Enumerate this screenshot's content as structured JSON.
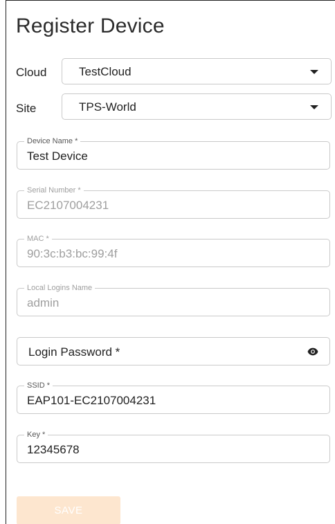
{
  "page": {
    "title": "Register Device"
  },
  "cloud": {
    "label": "Cloud",
    "value": "TestCloud"
  },
  "site": {
    "label": "Site",
    "value": "TPS-World"
  },
  "fields": {
    "device_name": {
      "label": "Device Name *",
      "value": "Test Device"
    },
    "serial_number": {
      "label": "Serial Number *",
      "value": "EC2107004231"
    },
    "mac": {
      "label": "MAC *",
      "value": "90:3c:b3:bc:99:4f"
    },
    "local_logins_name": {
      "label": "Local Logins Name",
      "value": "admin"
    },
    "login_password": {
      "label": "Login Password *",
      "icon": "eye-icon"
    },
    "ssid": {
      "label": "SSID *",
      "value": "EAP101-EC2107004231"
    },
    "key": {
      "label": "Key *",
      "value": "12345678"
    }
  },
  "actions": {
    "save_label": "SAVE"
  },
  "colors": {
    "save_button_bg": "#fde6cf",
    "border": "#c9c9c9",
    "disabled_text": "#9e9e9e"
  }
}
